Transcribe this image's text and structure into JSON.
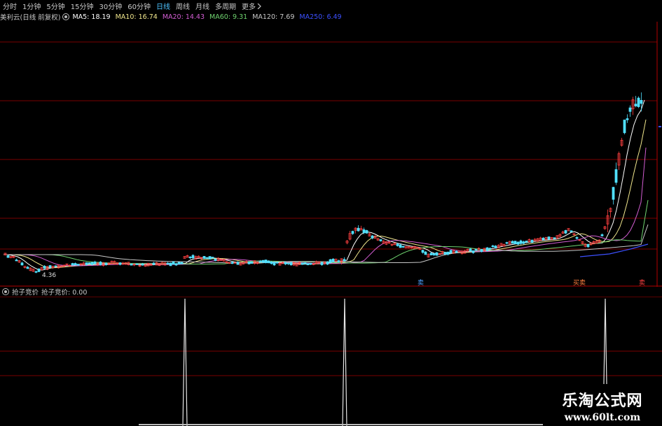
{
  "toolbar": {
    "tabs": [
      {
        "label": "分时"
      },
      {
        "label": "1分钟"
      },
      {
        "label": "5分钟"
      },
      {
        "label": "15分钟"
      },
      {
        "label": "30分钟"
      },
      {
        "label": "60分钟"
      },
      {
        "label": "日线",
        "active": true
      },
      {
        "label": "周线"
      },
      {
        "label": "月线"
      },
      {
        "label": "多周期"
      }
    ],
    "more_label": "更多",
    "more_icon": "chevron-right-icon"
  },
  "infobar": {
    "stock_title": "美利云(日线 前复权)",
    "settings_icon": "gear-icon",
    "ma_items": [
      {
        "label": "MA5: 18.19",
        "color": "#ffffff"
      },
      {
        "label": "MA10: 16.74",
        "color": "#f0e68c"
      },
      {
        "label": "MA20: 14.43",
        "color": "#d25dd2"
      },
      {
        "label": "MA60: 9.31",
        "color": "#6fd36f"
      },
      {
        "label": "MA120: 7.69",
        "color": "#c8c8c8"
      },
      {
        "label": "MA250: 6.49",
        "color": "#3c50ff"
      }
    ]
  },
  "main_chart": {
    "low_label": "4.36",
    "signal_labels": [
      "卖",
      "买卖",
      "卖"
    ]
  },
  "sub_chart": {
    "settings_icon": "gear-icon",
    "title": "抢子竞价",
    "value_label": "抢子竞价: 0.00"
  },
  "watermark": {
    "title": "乐淘公式网",
    "url": "www.60lt.com"
  },
  "colors": {
    "grid": "#7a0000",
    "axis": "#b40000",
    "candle_up": "#ff4040",
    "candle_down": "#50e0ff",
    "spike": "#e6e6e6",
    "active_tab": "#4ec3ff"
  }
}
